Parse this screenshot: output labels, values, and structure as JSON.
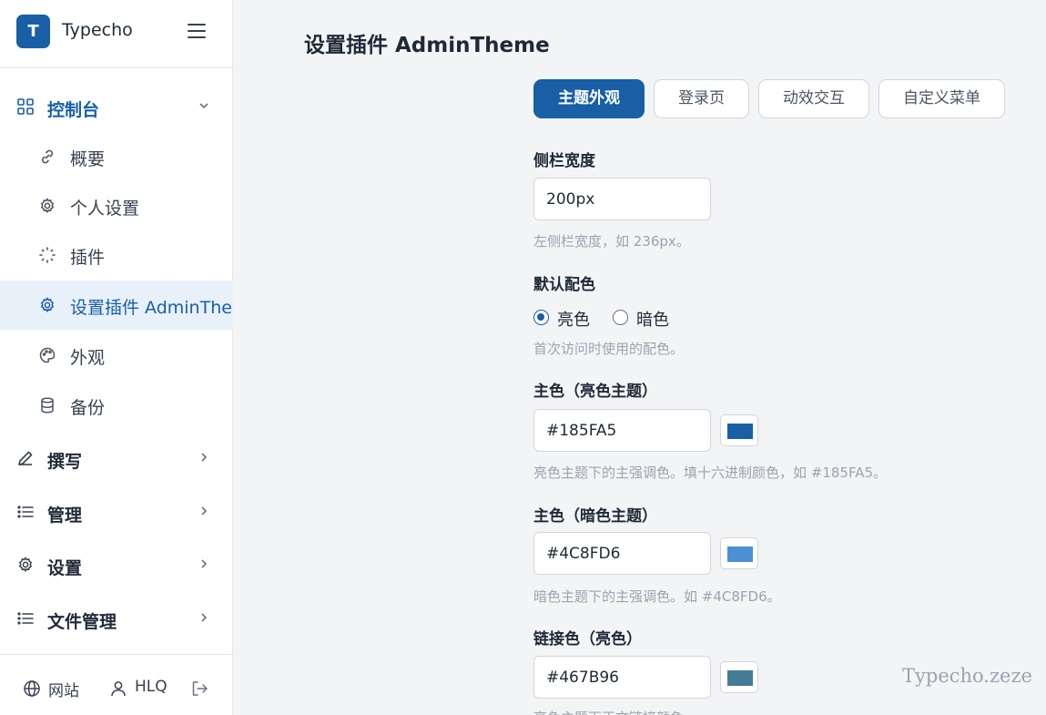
{
  "brand": {
    "logo_letter": "T",
    "name": "Typecho"
  },
  "sidebar": {
    "dashboard": {
      "label": "控制台",
      "icon": "grid-icon",
      "expanded": true,
      "items": [
        {
          "label": "概要",
          "icon": "link-icon"
        },
        {
          "label": "个人设置",
          "icon": "gear-icon"
        },
        {
          "label": "插件",
          "icon": "plugin-icon"
        },
        {
          "label": "设置插件 AdminTheme",
          "icon": "gear-icon",
          "current": true
        },
        {
          "label": "外观",
          "icon": "palette-icon"
        },
        {
          "label": "备份",
          "icon": "database-icon"
        }
      ]
    },
    "sections": [
      {
        "label": "撰写",
        "icon": "pencil-icon"
      },
      {
        "label": "管理",
        "icon": "list-icon"
      },
      {
        "label": "设置",
        "icon": "gear-icon"
      },
      {
        "label": "文件管理",
        "icon": "list-icon"
      }
    ],
    "footer": {
      "site": "网站",
      "user": "HLQ",
      "logout_icon": "logout-icon"
    }
  },
  "page": {
    "title": "设置插件 AdminTheme"
  },
  "tabs": [
    {
      "label": "主题外观",
      "active": true
    },
    {
      "label": "登录页",
      "active": false
    },
    {
      "label": "动效交互",
      "active": false
    },
    {
      "label": "自定义菜单",
      "active": false
    }
  ],
  "form": {
    "sidebar_width": {
      "label": "侧栏宽度",
      "value": "200px",
      "hint": "左侧栏宽度，如 236px。"
    },
    "default_scheme": {
      "label": "默认配色",
      "options": [
        {
          "label": "亮色",
          "checked": true
        },
        {
          "label": "暗色",
          "checked": false
        }
      ],
      "hint": "首次访问时使用的配色。"
    },
    "primary_light": {
      "label": "主色（亮色主题）",
      "value": "#185FA5",
      "swatch": "#185FA5",
      "hint": "亮色主题下的主强调色。填十六进制颜色，如 #185FA5。"
    },
    "primary_dark": {
      "label": "主色（暗色主题）",
      "value": "#4C8FD6",
      "swatch": "#4C8FD6",
      "hint": "暗色主题下的主强调色。如 #4C8FD6。"
    },
    "link_light": {
      "label": "链接色（亮色）",
      "value": "#467B96",
      "swatch": "#467B96",
      "hint": "亮色主题下正文链接颜色。"
    }
  },
  "watermark": "Typecho.zeze",
  "colors": {
    "accent": "#185fa5",
    "active_bg": "#e8f0fa"
  }
}
